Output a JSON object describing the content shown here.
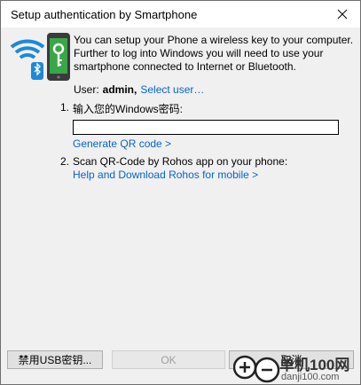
{
  "window": {
    "title": "Setup authentication by Smartphone"
  },
  "intro": {
    "text": "You can setup your Phone a wireless key to your computer. Further to log into Windows you will need to use your smartphone connected to Internet or Bluetooth."
  },
  "user": {
    "label": "User:",
    "name": "admin,",
    "select_link": "Select user…"
  },
  "step1": {
    "number": "1.",
    "text": "输入您的Windows密码:",
    "password_value": "",
    "generate_link": "Generate QR code >"
  },
  "step2": {
    "number": "2.",
    "text": "Scan QR-Code by Rohos app on your phone:",
    "help_link": "Help and Download Rohos for mobile >"
  },
  "buttons": {
    "usb": "禁用USB密钥...",
    "ok": "OK",
    "cancel": "取消"
  },
  "watermark": {
    "text": "单机100网",
    "sub": "danji100.com"
  },
  "colors": {
    "link": "#0a63c4",
    "logo_green": "#3aa64a",
    "wifi_blue": "#1e88d8"
  }
}
